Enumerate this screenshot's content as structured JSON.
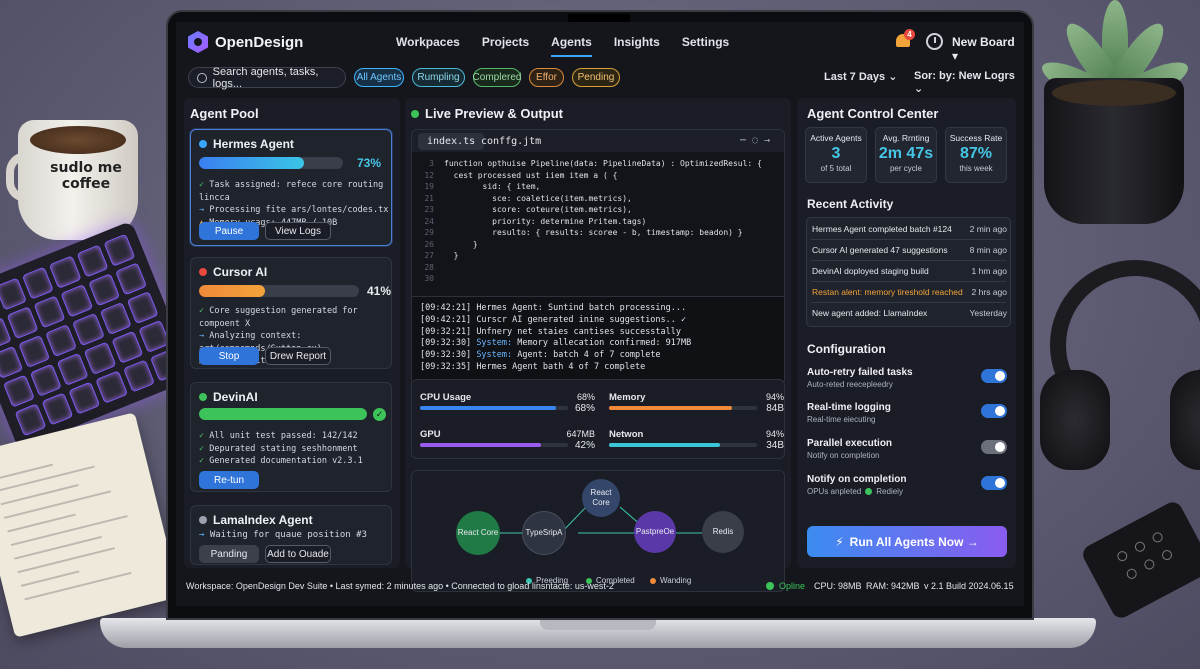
{
  "desk": {
    "mug_text": "sudlo me coffee"
  },
  "app": {
    "name": "OpenDesign",
    "board": "New Board ▾",
    "notif_count": "4"
  },
  "nav": [
    "Workpaces",
    "Projects",
    "Agents",
    "Insights",
    "Settings"
  ],
  "filters": {
    "search_placeholder": "Search agents, tasks, logs...",
    "chips": [
      "All Agents",
      "Rumpling",
      "Complered",
      "Effor",
      "Pending"
    ],
    "range": "Last 7 Days ⌄",
    "sort": "Sor: by: New Logrs ⌄"
  },
  "agent_pool": {
    "title": "Agent Pool",
    "agents": [
      {
        "name": "Hermes Agent",
        "percent": "73%",
        "progress": 73,
        "color": "#3aa7ff",
        "logs": [
          "Task assigned: refece core routing lincca",
          "Processing fite ars/lontes/codes.tx",
          "Memory ucags: 447MB / 10B"
        ],
        "buttons": [
          "Pause",
          "View Logs"
        ]
      },
      {
        "name": "Cursor AI",
        "percent": "41%",
        "progress": 41,
        "color": "#e7493d",
        "logs": [
          "Core suggestion generated for compoent X",
          "Analyzing context: art/compomnds/Sutton.cx)",
          "Teren limit: 94% used"
        ],
        "buttons": [
          "Stop",
          "Drew Report"
        ]
      },
      {
        "name": "DevinAI",
        "progress": 100,
        "color": "#3cc45a",
        "logs": [
          "All unit test passed: 142/142",
          "Depurated stating seshhonment",
          "Generated documentation v2.3.1"
        ],
        "buttons": [
          "Re-tun"
        ]
      },
      {
        "name": "LamaIndex Agent",
        "color": "#9aa0ac",
        "logs": [
          "Waiting for quaue position #3"
        ],
        "buttons": [
          "Panding",
          "Add to Ouade"
        ]
      }
    ]
  },
  "preview": {
    "title": "Live Preview & Output",
    "tabs": [
      "index.ts",
      "conffg.jtm"
    ],
    "code": [
      {
        "n": "3",
        "t": "function opthuise Pipeline(data: PipelineData) : OptimizedResul: {"
      },
      {
        "n": "",
        "t": ""
      },
      {
        "n": "12",
        "t": "  cest processed ust iiem item a ( {"
      },
      {
        "n": "19",
        "t": "        sid: { item,"
      },
      {
        "n": "21",
        "t": "          sce: coaletice(item.metrics),"
      },
      {
        "n": "23",
        "t": "          score: coteure(item.metrics),"
      },
      {
        "n": "24",
        "t": "          priority: determine Pritem.tags)"
      },
      {
        "n": "29",
        "t": "          resulto: { results: scoree - b, timestamp: beadon) }"
      },
      {
        "n": "26",
        "t": "      }"
      },
      {
        "n": "27",
        "t": "  }"
      },
      {
        "n": "28",
        "t": ""
      },
      {
        "n": "30",
        "t": ""
      }
    ],
    "console": [
      {
        "time": "[09:42:21]",
        "pre": "",
        "text": "Hermes Agent: Suntind batch processing..."
      },
      {
        "time": "[09:42:21]",
        "pre": "",
        "text": "Curscr AI generated inine suggestions.. ✓"
      },
      {
        "time": "[09:32:21]",
        "pre": "",
        "text": "Unfnery net staies cantises successtally"
      },
      {
        "time": "[09:32:30]",
        "pre": "System:",
        "text": "Memory allecation confirmed: 917MB"
      },
      {
        "time": "[09:32:30]",
        "pre": "System:",
        "text": "Agent: batch 4 of 7 complete"
      },
      {
        "time": "[09:32:35]",
        "pre": "",
        "text": "Hermes Agent bath 4 of 7 complete"
      }
    ]
  },
  "metrics": [
    {
      "label": "CPU Usage",
      "v1": "68%",
      "v2": "68%",
      "level": 0.92,
      "color": "#3a86f0"
    },
    {
      "label": "Memory",
      "v1": "94%",
      "v2": "84B",
      "level": 0.83,
      "color": "#f08a3a"
    },
    {
      "label": "GPU",
      "v1": "647MB",
      "v2": "42%",
      "level": 0.82,
      "color": "#9a5cf0"
    },
    {
      "label": "Netwon",
      "v1": "94%",
      "v2": "34B",
      "level": 0.75,
      "color": "#3ac6d6"
    }
  ],
  "graph": {
    "nodes": [
      "React Core",
      "TypeSripA",
      "React Core",
      "PastpreOe",
      "Redis"
    ],
    "legend": [
      "Preeding",
      "Completed",
      "Wanding"
    ]
  },
  "control": {
    "title": "Agent Control Center",
    "stats": [
      {
        "label": "Active Agents",
        "value": "3",
        "sub": "of 5 total"
      },
      {
        "label": "Avg. Rrnting",
        "value": "2m 47s",
        "sub": "per cycle"
      },
      {
        "label": "Success Rate",
        "value": "87%",
        "sub": "this week"
      }
    ],
    "activity_title": "Recent Activity",
    "activity": [
      {
        "text": "Hermes Agent completed batch #124",
        "time": "2 min ago",
        "warn": false
      },
      {
        "text": "Cursor AI generated 47 suggestions",
        "time": "8 min ago",
        "warn": false
      },
      {
        "text": "DevinAI doployed staging build",
        "time": "1 hm ago",
        "warn": false
      },
      {
        "text": "Restan alent: memory tireshold reached",
        "time": "2 hrs ago",
        "warn": true
      },
      {
        "text": "New agent added: LlamaIndex",
        "time": "Yesterday",
        "warn": false
      }
    ],
    "config_title": "Configuration",
    "config": [
      {
        "title": "Auto-retry failed tasks",
        "sub": "Auto-reted reecepleedry",
        "on": true
      },
      {
        "title": "Real-time logging",
        "sub": "Real-time eiecuting",
        "on": true
      },
      {
        "title": "Parallel execution",
        "sub": "Notify on completion",
        "on": false
      },
      {
        "title": "Notify on completion",
        "sub": "OPUs anpleted",
        "sub2": "Redieiy",
        "on": true
      }
    ],
    "run_button": "Run All Agents Now →"
  },
  "status": {
    "left": "Workspace: OpenDesign Dev Suite • Last symed: 2 minutes ago • Connected to gload linsntacte: us-west-2",
    "online": "Opline",
    "cpu": "CPU: 98MB",
    "ram": "RAM: 942MB",
    "build": "v 2.1 Build 2024.06.15"
  }
}
